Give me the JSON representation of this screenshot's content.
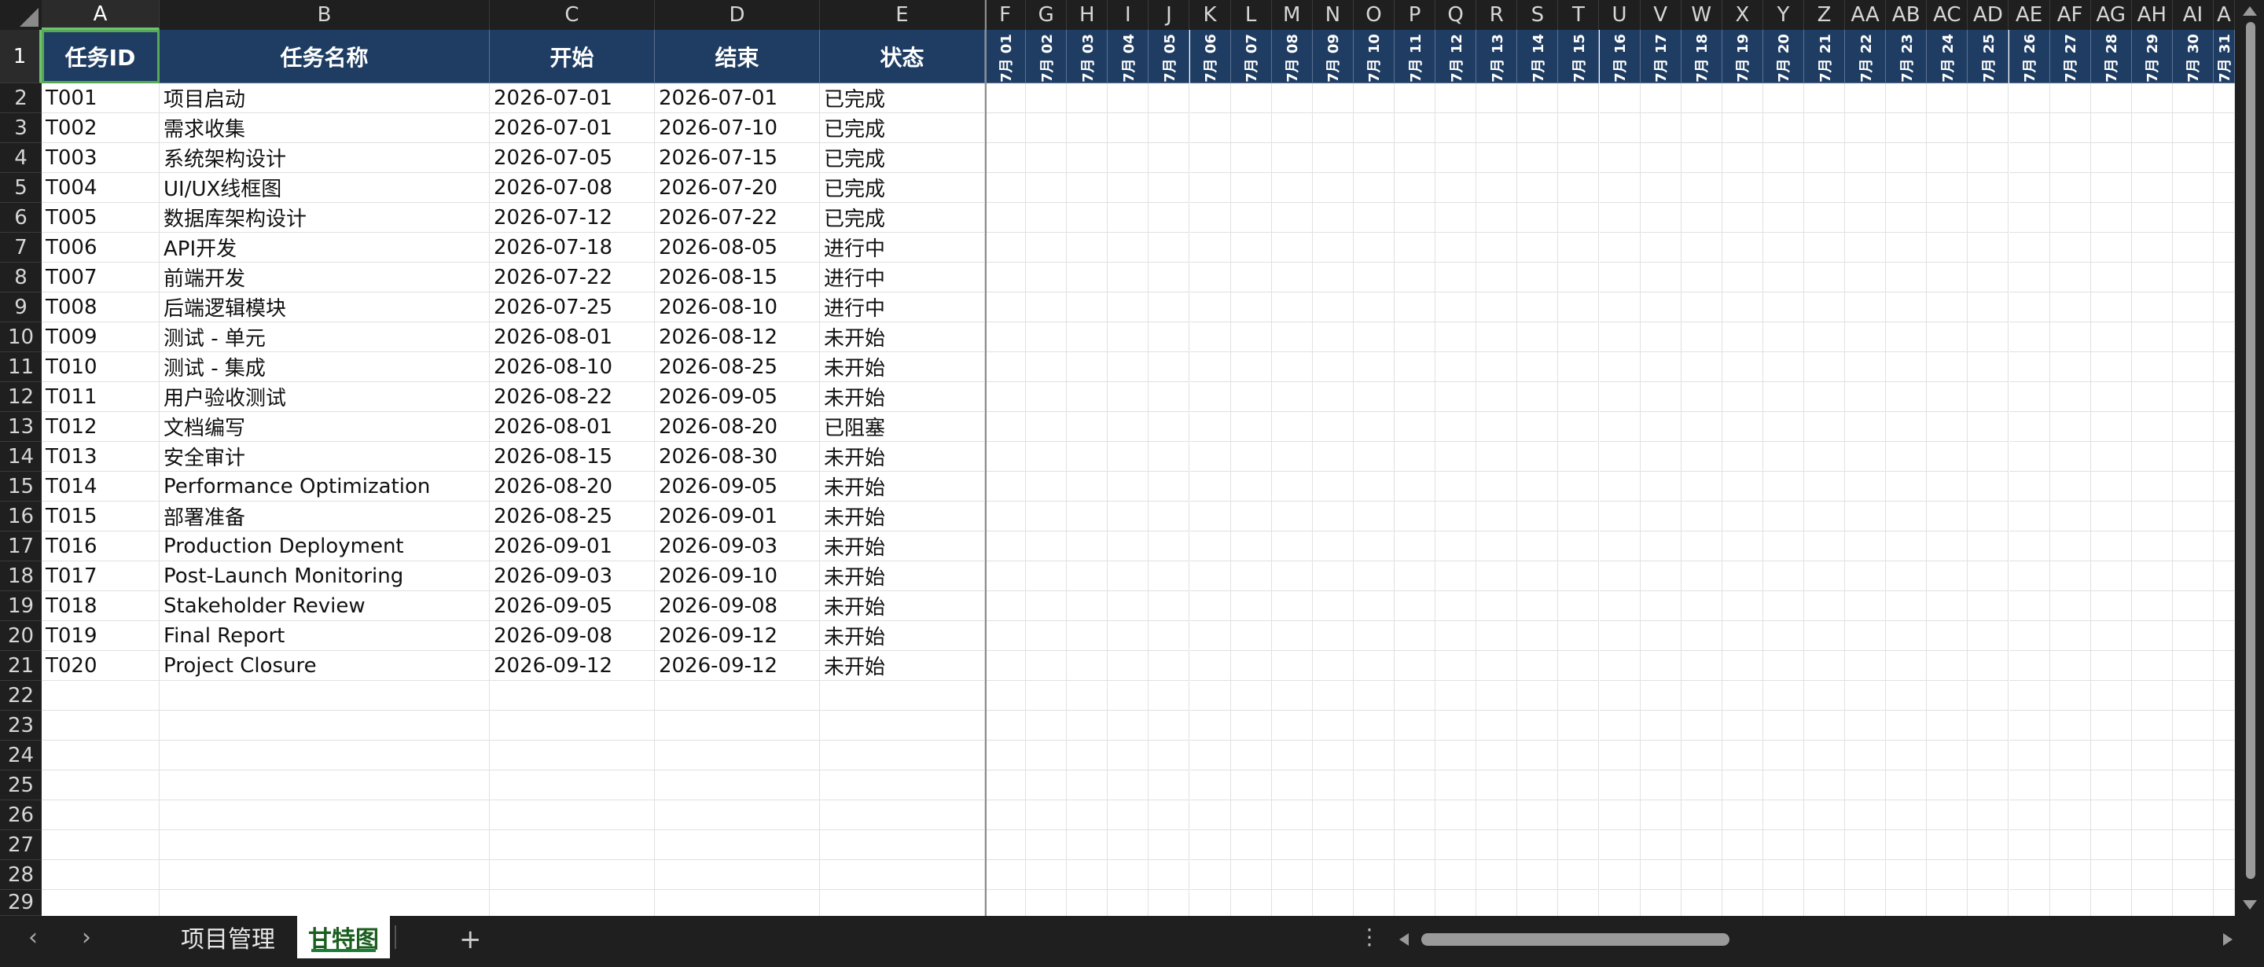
{
  "columns": [
    "A",
    "B",
    "C",
    "D",
    "E",
    "F",
    "G",
    "H",
    "I",
    "J",
    "K",
    "L",
    "M",
    "N",
    "O",
    "P",
    "Q",
    "R",
    "S",
    "T",
    "U",
    "V",
    "W",
    "X",
    "Y",
    "Z",
    "AA",
    "AB",
    "AC",
    "AD",
    "AE",
    "AF",
    "AG",
    "AH",
    "AI",
    "A"
  ],
  "header": {
    "task_id": "任务ID",
    "task_name": "任务名称",
    "start": "开始",
    "end": "结束",
    "status": "状态"
  },
  "date_columns": [
    "7月 01",
    "7月 02",
    "7月 03",
    "7月 04",
    "7月 05",
    "7月 06",
    "7月 07",
    "7月 08",
    "7月 09",
    "7月 10",
    "7月 11",
    "7月 12",
    "7月 13",
    "7月 14",
    "7月 15",
    "7月 16",
    "7月 17",
    "7月 18",
    "7月 19",
    "7月 20",
    "7月 21",
    "7月 22",
    "7月 23",
    "7月 24",
    "7月 25",
    "7月 26",
    "7月 27",
    "7月 28",
    "7月 29",
    "7月 30",
    "7月 31"
  ],
  "tasks": [
    {
      "id": "T001",
      "name": "项目启动",
      "start": "2026-07-01",
      "end": "2026-07-01",
      "status": "已完成"
    },
    {
      "id": "T002",
      "name": "需求收集",
      "start": "2026-07-01",
      "end": "2026-07-10",
      "status": "已完成"
    },
    {
      "id": "T003",
      "name": "系统架构设计",
      "start": "2026-07-05",
      "end": "2026-07-15",
      "status": "已完成"
    },
    {
      "id": "T004",
      "name": "UI/UX线框图",
      "start": "2026-07-08",
      "end": "2026-07-20",
      "status": "已完成"
    },
    {
      "id": "T005",
      "name": "数据库架构设计",
      "start": "2026-07-12",
      "end": "2026-07-22",
      "status": "已完成"
    },
    {
      "id": "T006",
      "name": "API开发",
      "start": "2026-07-18",
      "end": "2026-08-05",
      "status": "进行中"
    },
    {
      "id": "T007",
      "name": "前端开发",
      "start": "2026-07-22",
      "end": "2026-08-15",
      "status": "进行中"
    },
    {
      "id": "T008",
      "name": "后端逻辑模块",
      "start": "2026-07-25",
      "end": "2026-08-10",
      "status": "进行中"
    },
    {
      "id": "T009",
      "name": "测试 - 单元",
      "start": "2026-08-01",
      "end": "2026-08-12",
      "status": "未开始"
    },
    {
      "id": "T010",
      "name": "测试 - 集成",
      "start": "2026-08-10",
      "end": "2026-08-25",
      "status": "未开始"
    },
    {
      "id": "T011",
      "name": "用户验收测试",
      "start": "2026-08-22",
      "end": "2026-09-05",
      "status": "未开始"
    },
    {
      "id": "T012",
      "name": "文档编写",
      "start": "2026-08-01",
      "end": "2026-08-20",
      "status": "已阻塞"
    },
    {
      "id": "T013",
      "name": "安全审计",
      "start": "2026-08-15",
      "end": "2026-08-30",
      "status": "未开始"
    },
    {
      "id": "T014",
      "name": "Performance Optimization",
      "start": "2026-08-20",
      "end": "2026-09-05",
      "status": "未开始"
    },
    {
      "id": "T015",
      "name": "部署准备",
      "start": "2026-08-25",
      "end": "2026-09-01",
      "status": "未开始"
    },
    {
      "id": "T016",
      "name": "Production Deployment",
      "start": "2026-09-01",
      "end": "2026-09-03",
      "status": "未开始"
    },
    {
      "id": "T017",
      "name": "Post-Launch Monitoring",
      "start": "2026-09-03",
      "end": "2026-09-10",
      "status": "未开始"
    },
    {
      "id": "T018",
      "name": "Stakeholder Review",
      "start": "2026-09-05",
      "end": "2026-09-08",
      "status": "未开始"
    },
    {
      "id": "T019",
      "name": "Final Report",
      "start": "2026-09-08",
      "end": "2026-09-12",
      "status": "未开始"
    },
    {
      "id": "T020",
      "name": "Project Closure",
      "start": "2026-09-12",
      "end": "2026-09-12",
      "status": "未开始"
    }
  ],
  "row_numbers": [
    "1",
    "2",
    "3",
    "4",
    "5",
    "6",
    "7",
    "8",
    "9",
    "10",
    "11",
    "12",
    "13",
    "14",
    "15",
    "16",
    "17",
    "18",
    "19",
    "20",
    "21",
    "22",
    "23",
    "24",
    "25",
    "26",
    "27",
    "28",
    "29"
  ],
  "sheet_tabs": [
    {
      "label": "项目管理",
      "active": false
    },
    {
      "label": "甘特图",
      "active": true
    }
  ],
  "icons": {
    "prev_sheet": "chevron-left-icon",
    "next_sheet": "chevron-right-icon",
    "add_sheet": "plus-icon",
    "more": "more-vertical-icon"
  },
  "colors": {
    "header_bg": "#1f3d63",
    "selection": "#57a957",
    "active_tab_text": "#1b5e20"
  }
}
